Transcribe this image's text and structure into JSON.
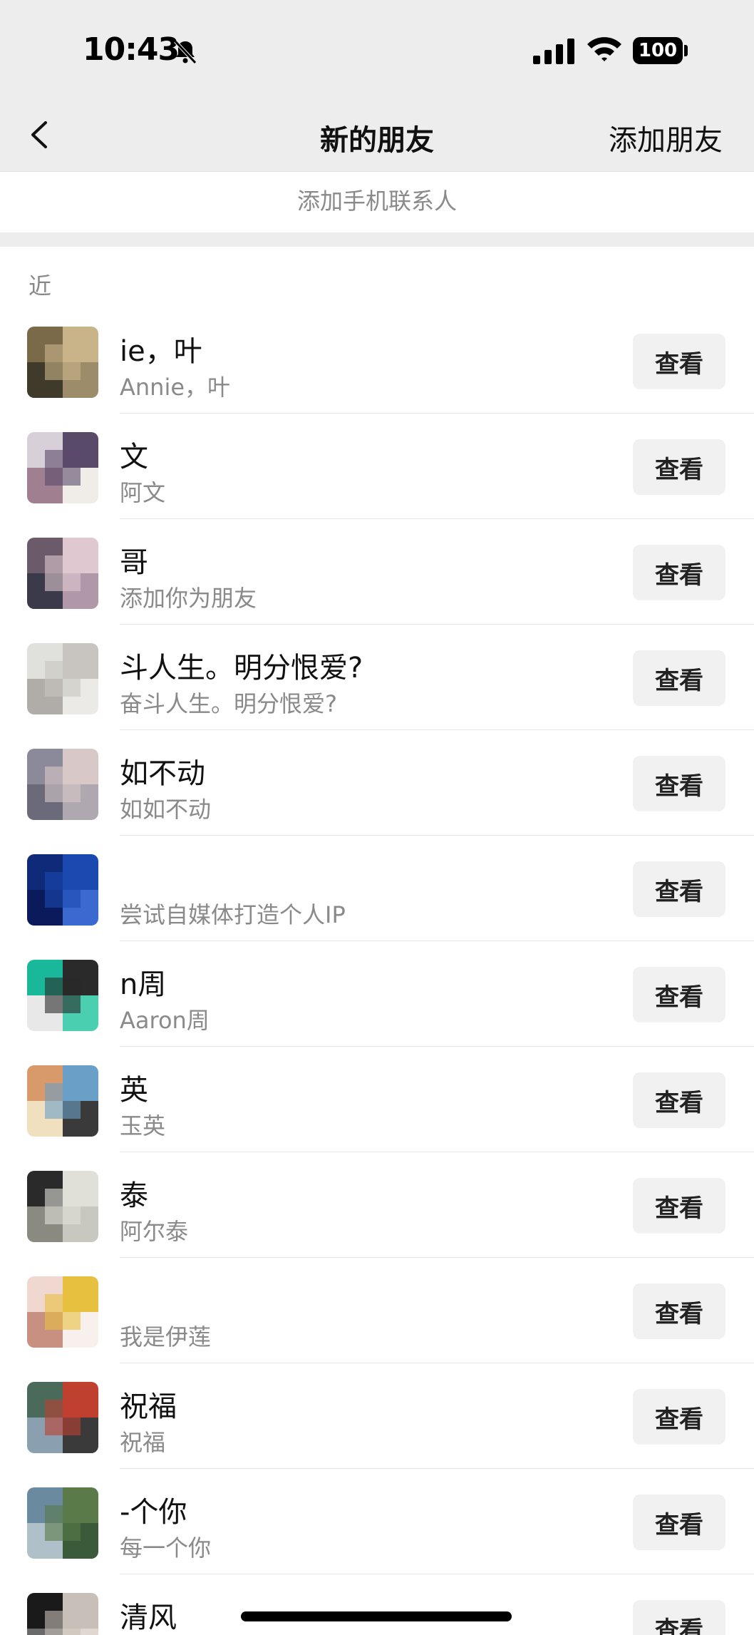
{
  "status_bar": {
    "time": "10:43",
    "battery": "100"
  },
  "nav": {
    "title": "新的朋友",
    "action": "添加朋友"
  },
  "phone_contacts": "添加手机联系人",
  "section_label": "近",
  "view_label": "查看",
  "friends": [
    {
      "name": "ie，叶",
      "message": "Annie，叶",
      "avatar_colors": [
        "#7a6a4a",
        "#c9b48a",
        "#3f3a2a",
        "#9c8c6a"
      ]
    },
    {
      "name": "文",
      "message": "阿文",
      "avatar_colors": [
        "#d8d0d8",
        "#5a4a6a",
        "#a08090",
        "#f0ece8"
      ]
    },
    {
      "name": "哥",
      "message": "添加你为朋友",
      "avatar_colors": [
        "#6a5a6a",
        "#e0c8d0",
        "#3a3a4a",
        "#b098a8"
      ]
    },
    {
      "name": "斗人生。明分恨爱?",
      "message": "奋斗人生。明分恨爱?",
      "avatar_colors": [
        "#e0e0dc",
        "#c8c4c0",
        "#b0aca8",
        "#eceae6"
      ]
    },
    {
      "name": "如不动",
      "message": "如如不动",
      "avatar_colors": [
        "#8a8a9a",
        "#d8c8c8",
        "#6a6a7a",
        "#b0a8b0"
      ]
    },
    {
      "name": "",
      "message": "尝试自媒体打造个人IP",
      "avatar_colors": [
        "#102a7a",
        "#1a4ab0",
        "#0a1a5a",
        "#3a6ad0"
      ]
    },
    {
      "name": "n周",
      "message": "Aaron周",
      "avatar_colors": [
        "#1ab89a",
        "#2a2a2a",
        "#e8e8e8",
        "#4ad0b0"
      ]
    },
    {
      "name": "英",
      "message": "玉英",
      "avatar_colors": [
        "#d89a6a",
        "#6aa0c8",
        "#f0e0c0",
        "#3a3a3a"
      ]
    },
    {
      "name": "泰",
      "message": "阿尔泰",
      "avatar_colors": [
        "#2a2a2a",
        "#e0e0d8",
        "#8a8a80",
        "#c8c8c0"
      ]
    },
    {
      "name": "",
      "message": "我是伊莲",
      "avatar_colors": [
        "#f0d8d0",
        "#e8c040",
        "#c89080",
        "#f8f0ec"
      ]
    },
    {
      "name": "祝福",
      "message": "祝福",
      "avatar_colors": [
        "#4a6a5a",
        "#c04030",
        "#8aa0b0",
        "#3a3a3a"
      ]
    },
    {
      "name": "-个你",
      "message": "每一个你",
      "avatar_colors": [
        "#6a8aa0",
        "#5a7a4a",
        "#b0c0c8",
        "#3a5a3a"
      ]
    },
    {
      "name": "清风",
      "message": "",
      "avatar_colors": [
        "#1a1a1a",
        "#c8c0b8",
        "#6a6a6a",
        "#e0d8d0"
      ]
    }
  ]
}
